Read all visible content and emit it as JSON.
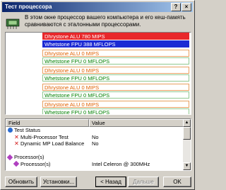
{
  "window": {
    "title": "Тест процессора",
    "help_label": "?",
    "close_label": "×"
  },
  "header": {
    "text": "В этом окне процессор вашего компьютера и его кеш-память сравниваются с эталонными процессорами."
  },
  "bars": [
    {
      "label": "Dhrystone ALU 780 MIPS",
      "style": "filled-red",
      "fill": 1.0
    },
    {
      "label": "Whetstone FPU 388 MFLOPS",
      "style": "filled-blue",
      "fill": 1.0
    },
    {
      "label": "Dhrystone ALU 0 MIPS",
      "style": "empty-orange",
      "fill": 0
    },
    {
      "label": "Whetstone FPU 0 MFLOPS",
      "style": "empty-green",
      "fill": 0
    },
    {
      "label": "Dhrystone ALU 0 MIPS",
      "style": "empty-orange",
      "fill": 0
    },
    {
      "label": "Whetstone FPU 0 MFLOPS",
      "style": "empty-green",
      "fill": 0
    },
    {
      "label": "Dhrystone ALU 0 MIPS",
      "style": "empty-orange",
      "fill": 0
    },
    {
      "label": "Whetstone FPU 0 MFLOPS",
      "style": "empty-green",
      "fill": 0
    },
    {
      "label": "Dhrystone ALU 0 MIPS",
      "style": "empty-orange",
      "fill": 0
    },
    {
      "label": "Whetstone FPU 0 MFLOPS",
      "style": "empty-green",
      "fill": 0
    }
  ],
  "grid": {
    "columns": [
      "Field",
      "Value"
    ],
    "rows": [
      {
        "field": "Test Status",
        "value": "",
        "icon": "check-icon",
        "indent": 0
      },
      {
        "field": "Multi-Processor Test",
        "value": "No",
        "icon": "x-icon",
        "indent": 1
      },
      {
        "field": "Dynamic MP Load Balance",
        "value": "No",
        "icon": "x-icon",
        "indent": 1
      },
      {
        "field": "",
        "value": "",
        "icon": "",
        "indent": 0
      },
      {
        "field": "Processor(s)",
        "value": "",
        "icon": "diamond-icon",
        "indent": 0
      },
      {
        "field": "Processor(s)",
        "value": "Intel Celeron @ 300MHz",
        "icon": "diamond-icon",
        "indent": 1
      }
    ]
  },
  "buttons": {
    "refresh": "Обновить",
    "settings": "Установки...",
    "back": "< Назад",
    "next": "Дальше",
    "ok": "OK"
  }
}
